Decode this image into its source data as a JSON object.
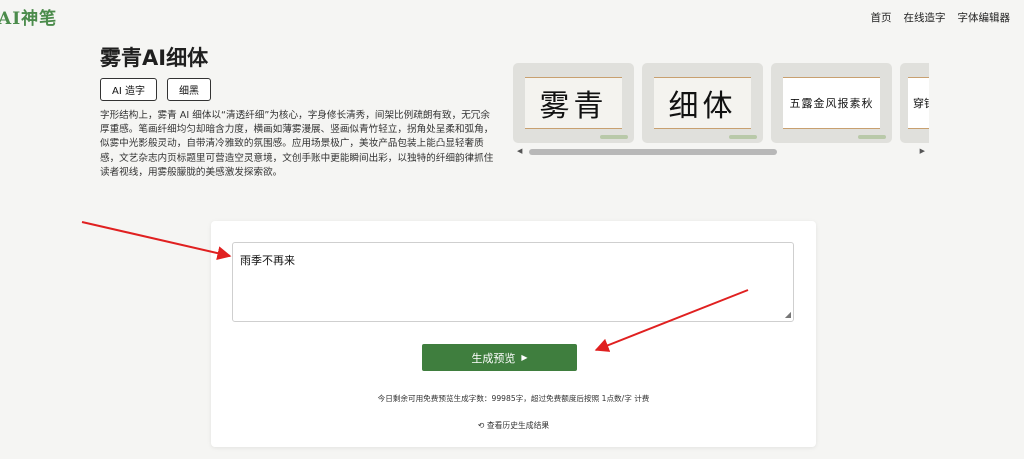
{
  "header": {
    "logo": "AI神笔",
    "nav": [
      "首页",
      "在线造字",
      "字体编辑器"
    ]
  },
  "font": {
    "title": "雾青AI细体",
    "tags": [
      "AI 造字",
      "细黑"
    ],
    "description": "字形结构上，雾青 AI 细体以“清透纤细”为核心，字身修长清秀，间架比例疏朗有致，无冗余厚重感。笔画纤细均匀却暗含力度，横画如薄雾漫展、竖画似青竹轻立，拐角处呈柔和弧角，似雾中光影般灵动，自带清冷雅致的氛围感。应用场景极广，美妆产品包装上能凸显轻奢质感，文艺杂志内页标题里可营造空灵意境，文创手账中更能瞬间出彩，以独特的纤细韵律抓住读者视线，用雾般朦胧的美感激发探索欲。"
  },
  "samples": [
    "雾青",
    "细体",
    "五露金风报素秋",
    "穿针"
  ],
  "editor": {
    "input_value": "雨季不再来",
    "generate_label": "生成预览",
    "quota_text": "今日剩余可用免费预览生成字数：99985字，超过免费额度后按照 1点数/字 计费",
    "history_label": "查看历史生成结果"
  },
  "colors": {
    "accent": "#3f7e3e",
    "logo": "#4b8b4b",
    "annotation_arrow": "#e02020"
  },
  "icons": {
    "play": "play-triangle-icon",
    "history": "history-icon"
  }
}
